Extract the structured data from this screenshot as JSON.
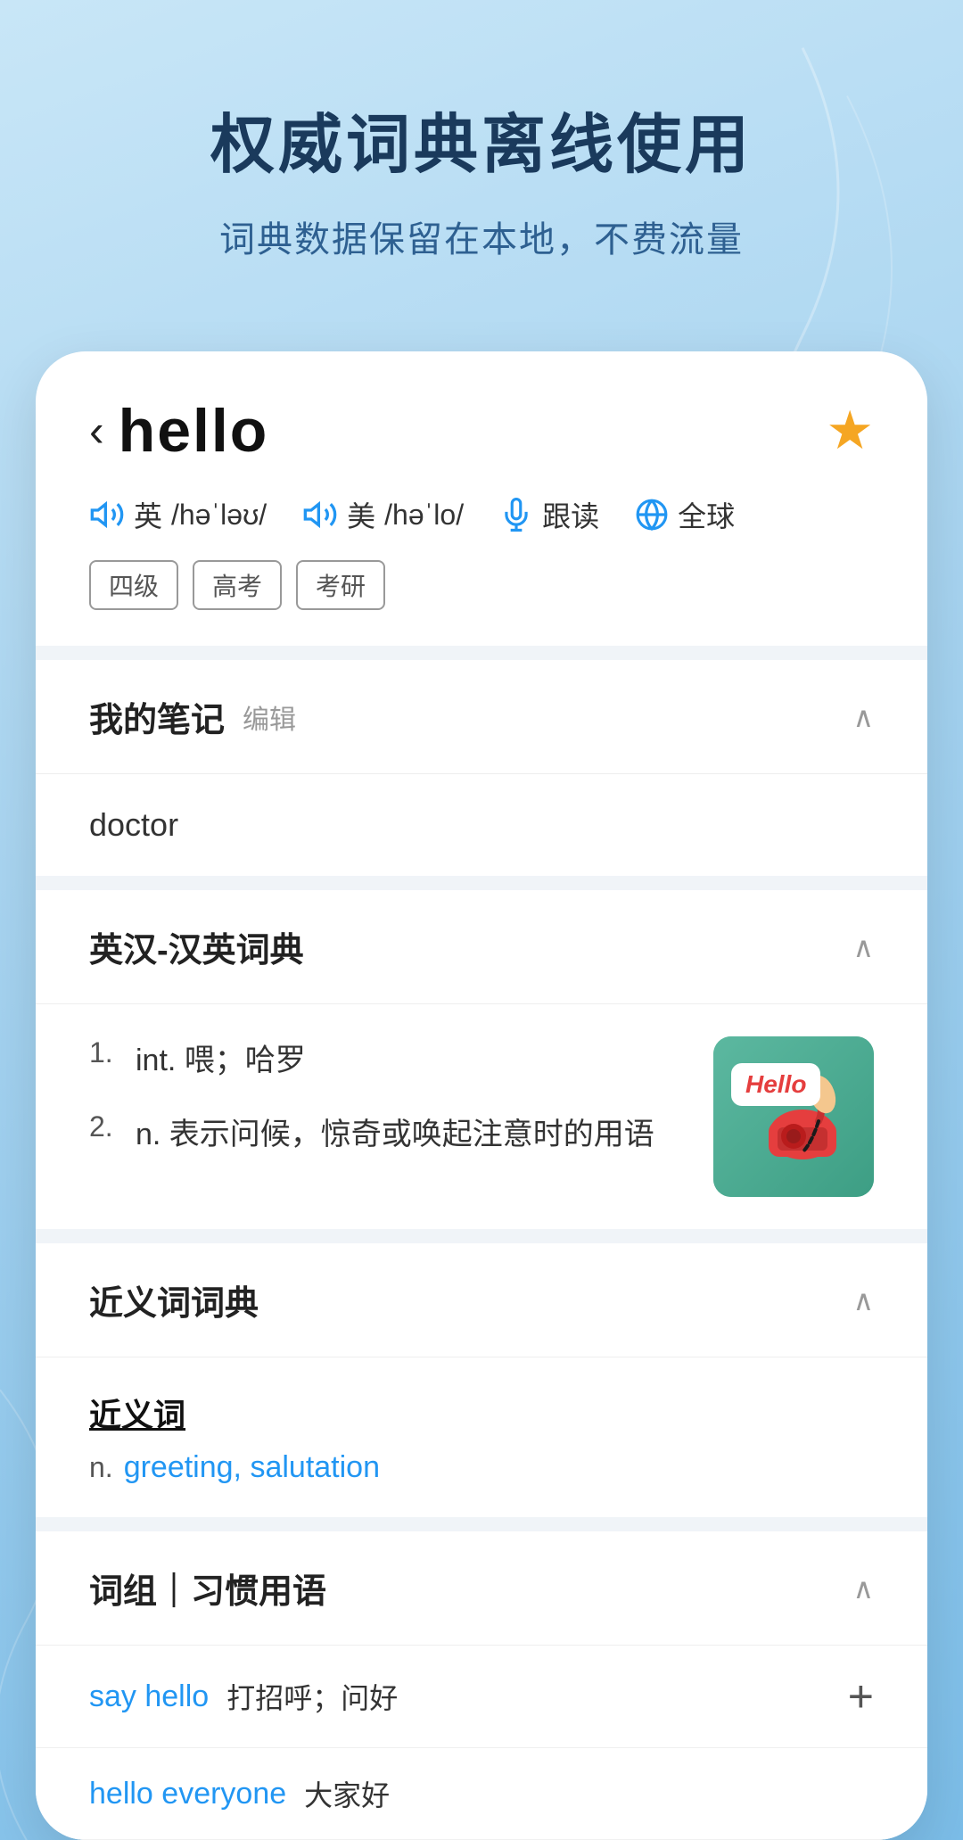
{
  "background": {
    "main_title": "权威词典离线使用",
    "sub_title": "词典数据保留在本地，不费流量"
  },
  "word_card": {
    "back_label": "‹",
    "word": "hello",
    "star_label": "★",
    "british_label": "英",
    "british_phonetic": "/həˈləʊ/",
    "american_label": "美",
    "american_phonetic": "/həˈlo/",
    "follow_read_label": "跟读",
    "global_label": "全球",
    "tags": [
      "四级",
      "高考",
      "考研"
    ]
  },
  "my_notes": {
    "section_title": "我的笔记",
    "edit_label": "编辑",
    "note_text": "doctor"
  },
  "dictionary": {
    "section_title": "英汉-汉英词典",
    "definitions": [
      {
        "num": "1.",
        "pos": "int.",
        "def": "喂；哈罗"
      },
      {
        "num": "2.",
        "pos": "n.",
        "def": "表示问候，惊奇或唤起注意时的用语"
      }
    ],
    "image_hello_text": "Hello"
  },
  "synonyms": {
    "section_title": "近义词词典",
    "group_label": "近义词",
    "pos": "n.",
    "words": "greeting, salutation"
  },
  "phrases": {
    "section_title": "词组｜习惯用语",
    "items": [
      {
        "word": "say hello",
        "meaning": "打招呼；问好",
        "has_add": true
      },
      {
        "word": "hello everyone",
        "meaning": "大家好",
        "has_add": false
      }
    ]
  }
}
